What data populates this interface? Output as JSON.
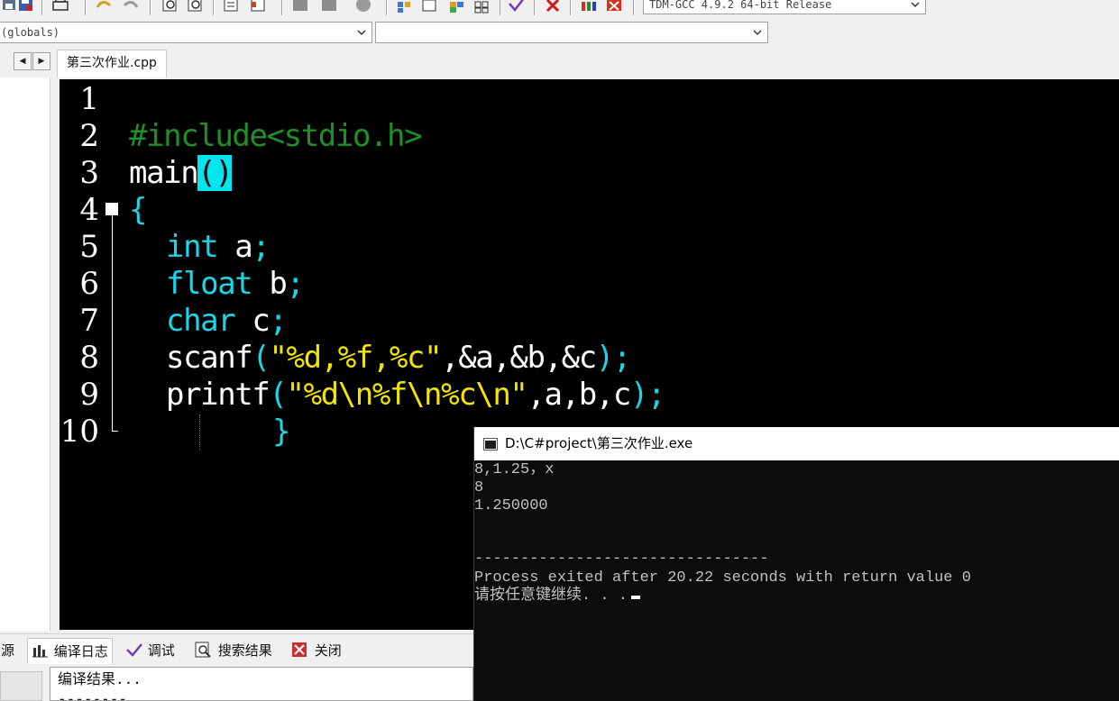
{
  "toolbar": {
    "compiler_select": "TDM-GCC 4.9.2 64-bit Release",
    "icons": [
      "save-all-icon",
      "close-file-icon",
      "print-icon",
      "undo-icon",
      "redo-icon",
      "find-icon",
      "replace-icon",
      "goto-icon",
      "bookmark-icon",
      "compile-icon",
      "run-icon",
      "stop-icon",
      "new-class-icon",
      "insert-icon",
      "toggle-bookmark-icon",
      "goto-bookmark-icon",
      "check-syntax-icon",
      "delete-icon",
      "chart-icon",
      "profile-delete-icon"
    ]
  },
  "combos": {
    "scope": "(globals)",
    "member": ""
  },
  "tabs": {
    "file_tab": "第三次作业.cpp"
  },
  "editor": {
    "line_numbers": [
      "1",
      "2",
      "3",
      "4",
      "5",
      "6",
      "7",
      "8",
      "9",
      "10"
    ],
    "lines": {
      "l2_include": "#include<stdio.h>",
      "l3_main": "main",
      "l3_parens": "()",
      "l4_brace": "{",
      "l5_kw": "int",
      "l5_rest": " a",
      "l5_semi": ";",
      "l6_kw": "float",
      "l6_rest": " b",
      "l6_semi": ";",
      "l7_kw": "char",
      "l7_rest": " c",
      "l7_semi": ";",
      "l8_fn": "scanf",
      "l8_open": "(",
      "l8_str": "\"%d,%f,%c\"",
      "l8_args": ",&a,&b,&c",
      "l8_close": ");",
      "l9_fn": "printf",
      "l9_open": "(",
      "l9_str": "\"%d\\n%f\\n%c\\n\"",
      "l9_args": ",a,b,c",
      "l9_close": ");",
      "l10_brace": "}"
    },
    "colors": {
      "background": "#000000",
      "keyword": "#1ad6e6",
      "preprocessor": "#1f8f2a",
      "string": "#f2e600",
      "highlight": "#00e5ee"
    }
  },
  "bottom_tabs": {
    "resources": "资源",
    "compile_log": "编译日志",
    "debug": "调试",
    "search_results": "搜索结果",
    "close": "关闭"
  },
  "compile_log": {
    "line1": "编译结果...",
    "line2": "--------"
  },
  "console": {
    "title": "D:\\C#project\\第三次作业.exe",
    "lines": [
      "8,1.25，x",
      "8",
      "1.250000",
      "",
      "--------------------------------",
      "Process exited after 20.22 seconds with return value 0",
      "请按任意键继续. . ."
    ]
  }
}
